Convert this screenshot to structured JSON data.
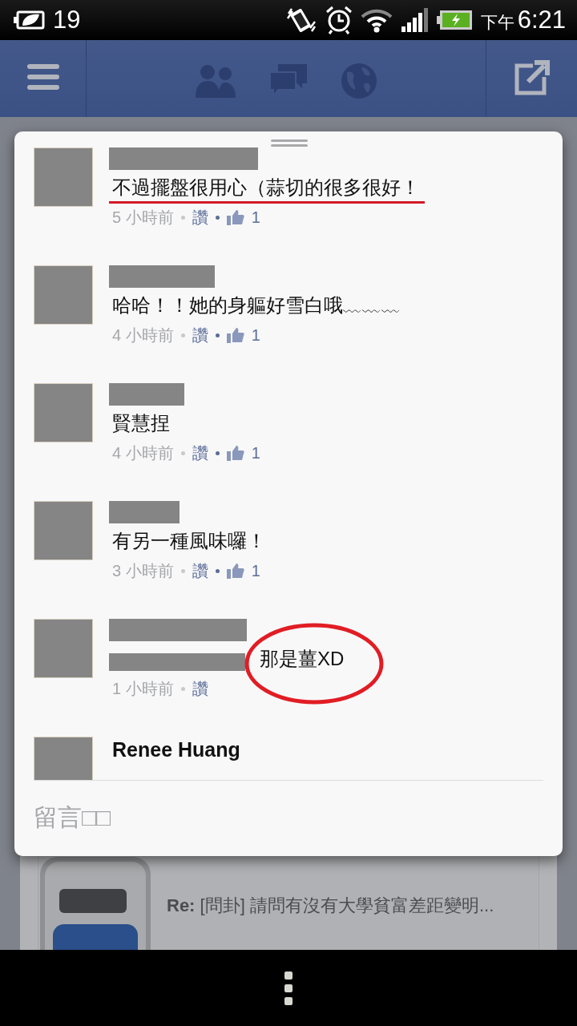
{
  "status_bar": {
    "notification_count": "19",
    "period": "下午",
    "time": "6:21"
  },
  "comments": [
    {
      "kind": "plain",
      "text": "不過擺盤很用心（蒜切的很多很好！",
      "time": "5 小時前",
      "like_label": "讚",
      "likes": "1",
      "underlined": true
    },
    {
      "kind": "plain",
      "text": "哈哈！！她的身軀好雪白哦﹏﹏﹏",
      "time": "4 小時前",
      "like_label": "讚",
      "likes": "1"
    },
    {
      "kind": "plain",
      "text": "賢慧捏",
      "time": "4 小時前",
      "like_label": "讚",
      "likes": "1"
    },
    {
      "kind": "plain",
      "text": "有另一種風味囉！",
      "time": "3 小時前",
      "like_label": "讚",
      "likes": "1"
    },
    {
      "kind": "reply",
      "text": "那是薑XD",
      "time": "1 小時前",
      "like_label": "讚",
      "circled": true
    },
    {
      "kind": "plain",
      "author": "Renee Huang"
    }
  ],
  "composer": {
    "placeholder": "留言□□"
  },
  "background_post": {
    "link_title": "**Re:** [問卦] 請問有沒有大學貧富差距變明..."
  }
}
